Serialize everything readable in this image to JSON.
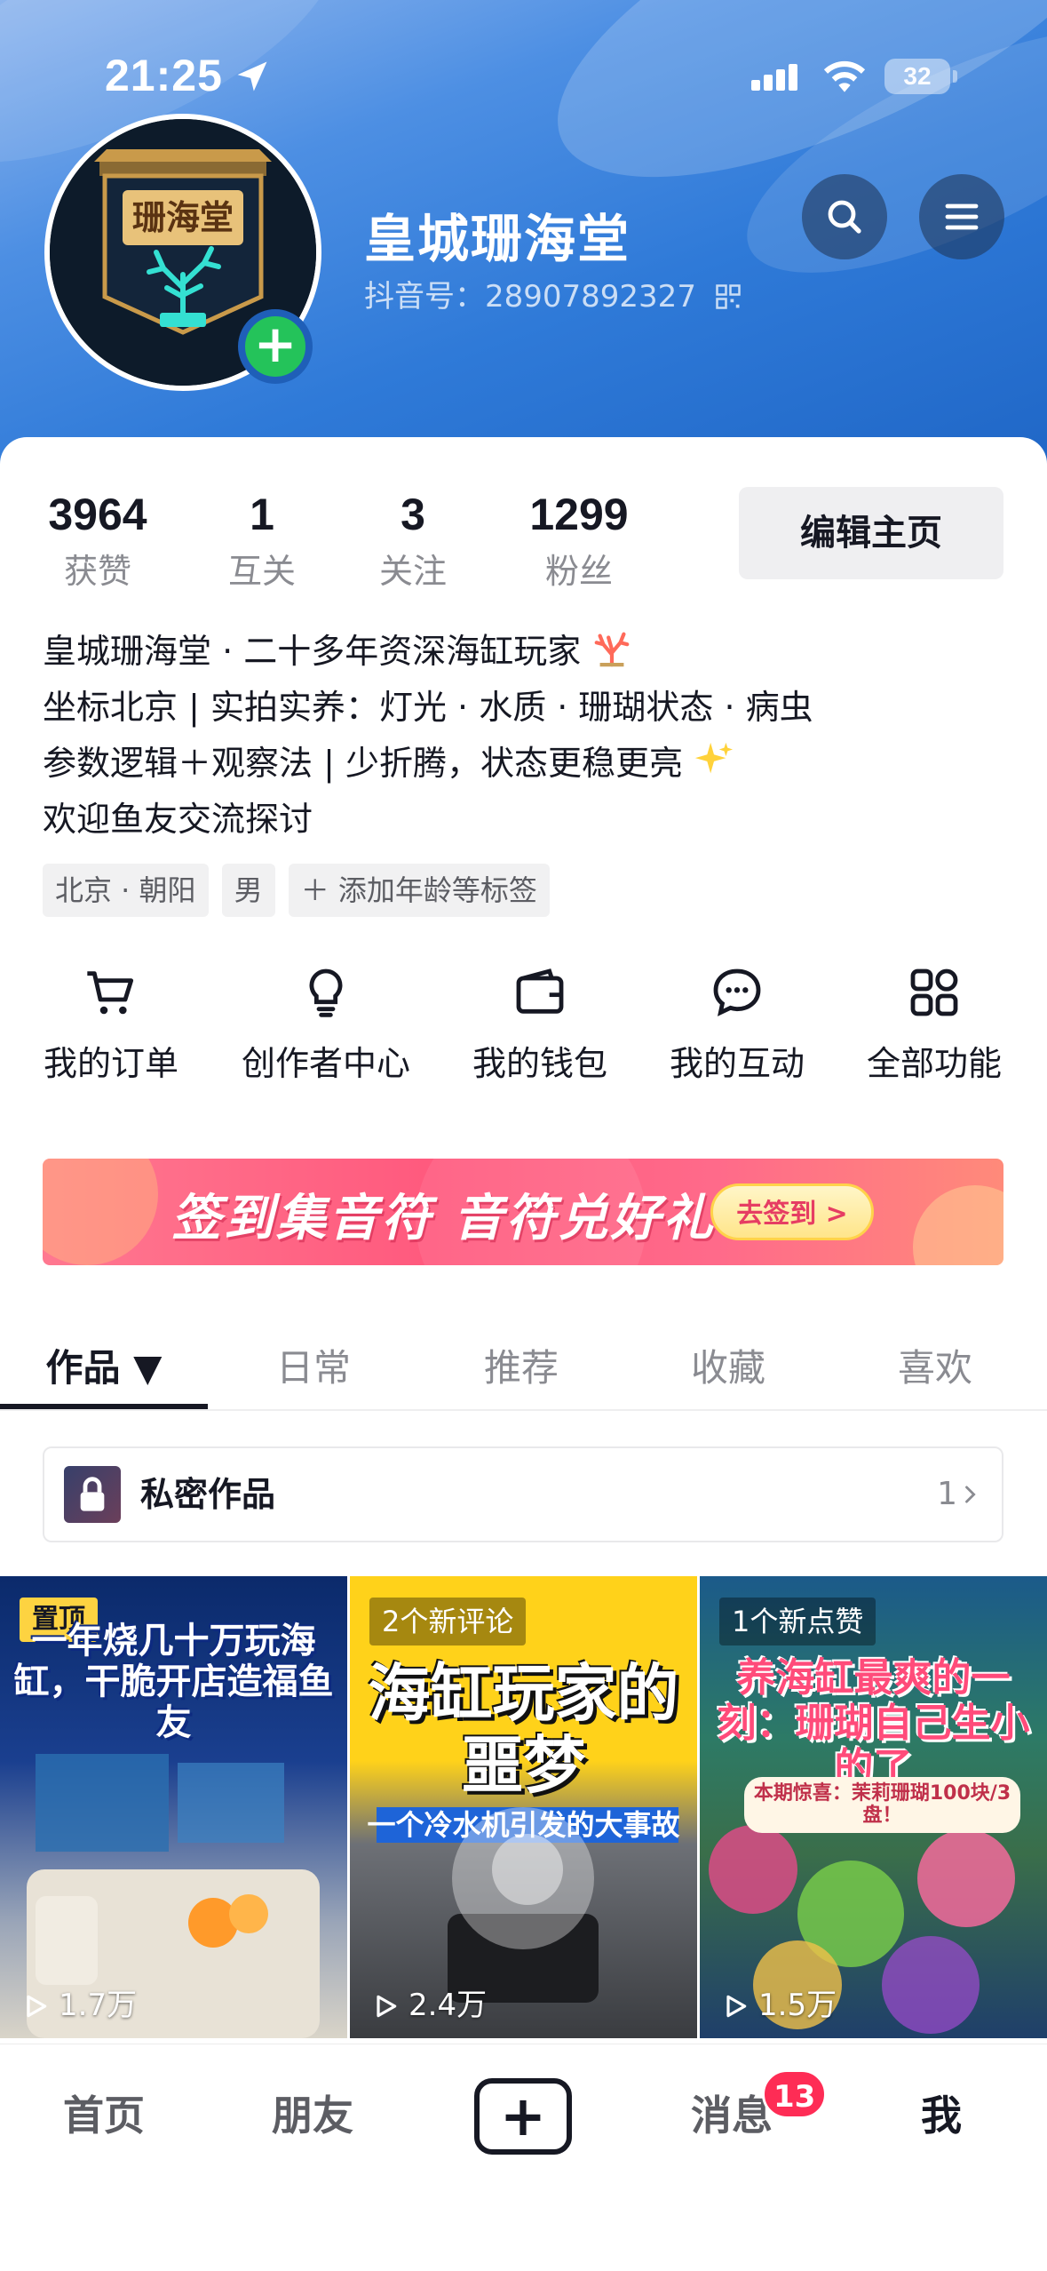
{
  "status_bar": {
    "time": "21:25",
    "battery": "32",
    "location_icon": "location-arrow-icon",
    "signal_icon": "signal-icon",
    "wifi_icon": "wifi-icon"
  },
  "profile": {
    "name": "皇城珊海堂",
    "douyin_id": "抖音号：28907892327",
    "avatar_text": "珊海堂",
    "add_icon": "plus-icon"
  },
  "header_actions": {
    "search_icon": "search-icon",
    "menu_icon": "menu-icon"
  },
  "stats": [
    {
      "value": "3964",
      "label": "获赞"
    },
    {
      "value": "1",
      "label": "互关"
    },
    {
      "value": "3",
      "label": "关注"
    },
    {
      "value": "1299",
      "label": "粉丝"
    }
  ],
  "edit_button": "编辑主页",
  "bio": {
    "line1": "皇城珊海堂 · 二十多年资深海缸玩家",
    "line2": "坐标北京 | 实拍实养：灯光 · 水质 · 珊瑚状态 · 病虫",
    "line3": "参数逻辑＋观察法 | 少折腾，状态更稳更亮",
    "line4": "欢迎鱼友交流探讨",
    "emoji1": "coral-emoji",
    "emoji2": "sparkles-emoji"
  },
  "tags": [
    "北京 · 朝阳",
    "男",
    "＋ 添加年龄等标签"
  ],
  "shortcuts": [
    {
      "label": "我的订单",
      "icon": "cart-icon"
    },
    {
      "label": "创作者中心",
      "icon": "lightbulb-icon"
    },
    {
      "label": "我的钱包",
      "icon": "wallet-icon"
    },
    {
      "label": "我的互动",
      "icon": "chat-bubble-icon"
    },
    {
      "label": "全部功能",
      "icon": "grid-icon"
    }
  ],
  "banner": {
    "text": "签到集音符 音符兑好礼",
    "button": "去签到 >"
  },
  "tabs": [
    {
      "label": "作品 ▼",
      "active": true
    },
    {
      "label": "日常",
      "active": false
    },
    {
      "label": "推荐",
      "active": false
    },
    {
      "label": "收藏",
      "active": false
    },
    {
      "label": "喜欢",
      "active": false
    }
  ],
  "private_works": {
    "label": "私密作品",
    "count": "1"
  },
  "videos": [
    {
      "badge": "置顶",
      "title": "一年烧几十万玩海缸，干脆开店造福鱼友",
      "plays": "1.7万"
    },
    {
      "note": "2个新评论",
      "title": "海缸玩家的噩梦",
      "subtitle": "一个冷水机引发的大事故",
      "plays": "2.4万"
    },
    {
      "note": "1个新点赞",
      "title": "养海缸最爽的一刻：珊瑚自己生小的了",
      "subtitle": "本期惊喜：茉莉珊瑚100块/3盘！",
      "plays": "1.5万"
    }
  ],
  "bottom_nav": {
    "home": "首页",
    "friends": "朋友",
    "plus": "+",
    "messages": "消息",
    "messages_badge": "13",
    "me": "我"
  },
  "colors": {
    "header_blue": "#2f7ad8",
    "accent_red": "#fe2c55",
    "green_add": "#24c35a",
    "pin_yellow": "#fdd341"
  }
}
